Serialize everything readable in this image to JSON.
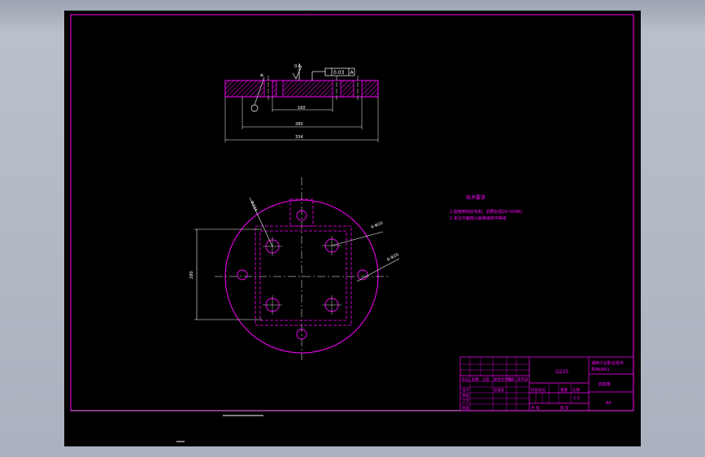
{
  "colors": {
    "canvas": "#000000",
    "magenta": "#ff00ff",
    "white": "#ffffff",
    "frame": "#ff00ff"
  },
  "drawing": {
    "dim_thickness_note": "0.4",
    "flatness_tolerance": "0.03",
    "datum": "A",
    "dim_inner": "160",
    "dim_mid": "280",
    "dim_outer": "334",
    "dim_height": "280",
    "dim_hole_a": "6-Φ20",
    "dim_hole_b": "6-Φ20",
    "dim_dia": "Φ334"
  },
  "tech_req": {
    "title": "技术要求",
    "line1": "1.锐角倒钝去毛刺，调质处理28-32HRC",
    "line2": "2.未注平面度公差等级按中等级"
  },
  "title_block": {
    "material": "Q235",
    "school": "湖南工业职业技术",
    "class": "机电0801",
    "part_name": "底座板",
    "scale": "1:2",
    "sheet": "A4",
    "labels": [
      "标记",
      "处数",
      "分区",
      "更改文件号",
      "签名",
      "年月日",
      "设计",
      "标准化",
      "阶段标记",
      "重量",
      "比例",
      "审核",
      "工艺",
      "批准",
      "共 张",
      "第 张"
    ]
  }
}
